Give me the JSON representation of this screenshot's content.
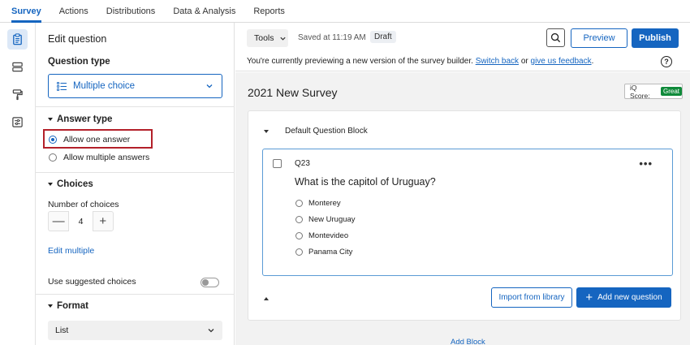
{
  "topnav": {
    "items": [
      {
        "label": "Survey",
        "active": true
      },
      {
        "label": "Actions",
        "active": false
      },
      {
        "label": "Distributions",
        "active": false
      },
      {
        "label": "Data & Analysis",
        "active": false
      },
      {
        "label": "Reports",
        "active": false
      }
    ]
  },
  "rail": {
    "icons": [
      "survey-clipboard-icon",
      "block-layout-icon",
      "paint-roller-icon",
      "survey-options-icon"
    ]
  },
  "panel": {
    "title": "Edit question",
    "question_type_label": "Question type",
    "question_type_value": "Multiple choice",
    "answer_type": {
      "label": "Answer type",
      "options": [
        {
          "label": "Allow one answer",
          "checked": true
        },
        {
          "label": "Allow multiple answers",
          "checked": false
        }
      ]
    },
    "choices": {
      "label": "Choices",
      "number_label": "Number of choices",
      "number_value": "4",
      "minus": "—",
      "plus": "+",
      "edit_multiple": "Edit multiple",
      "suggested_label": "Use suggested choices",
      "suggested_on": false
    },
    "format": {
      "label": "Format",
      "value": "List"
    }
  },
  "toolbar": {
    "tools_label": "Tools",
    "saved_text": "Saved at 11:19 AM",
    "draft_label": "Draft",
    "preview_label": "Preview",
    "publish_label": "Publish"
  },
  "notice": {
    "text_before": "You're currently previewing a new version of the survey builder. ",
    "switch_back": "Switch back",
    "or": " or ",
    "feedback": "give us feedback",
    "period": ".",
    "help": "?"
  },
  "canvas": {
    "survey_title": "2021 New Survey",
    "iq_score_label": "iQ Score:",
    "iq_score_value": "Great",
    "block_name": "Default Question Block",
    "question": {
      "id": "Q23",
      "more": "•••",
      "text": "What is the capitol of Uruguay?",
      "choices": [
        "Monterey",
        "New Uruguay",
        "Montevideo",
        "Panama City"
      ]
    },
    "import_label": "Import from library",
    "add_question_label": "Add new question",
    "add_question_plus": "+",
    "add_block_label": "Add Block"
  },
  "colors": {
    "accent": "#1565c0",
    "highlight": "#b3202a",
    "great_badge": "#0f8a3a",
    "canvas_bg": "#f2f2f2"
  }
}
